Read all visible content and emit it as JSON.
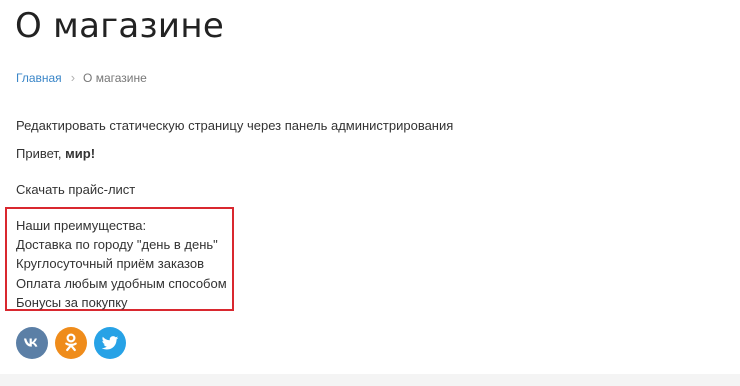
{
  "page": {
    "title": "О магазине"
  },
  "breadcrumb": {
    "home": "Главная",
    "separator": "›",
    "current": "О магазине"
  },
  "content": {
    "edit_text": "Редактировать статическую страницу через панель администрирования",
    "greeting_prefix": "Привет, ",
    "greeting_bold": "мир!",
    "download_price": "Скачать прайс-лист"
  },
  "advantages": {
    "heading": "Наши преимущества:",
    "items": [
      "Доставка по городу \"день в день\"",
      "Круглосуточный приём заказов",
      "Оплата любым удобным способом",
      "Бонусы за покупку"
    ],
    "highlight_color": "#d9282f"
  },
  "social": {
    "buttons": [
      {
        "icon": "vk-icon",
        "color": "#5b7fa6"
      },
      {
        "icon": "odnoklassniki-icon",
        "color": "#ef8c1b"
      },
      {
        "icon": "twitter-icon",
        "color": "#27a2e6"
      }
    ]
  },
  "colors": {
    "link": "#3a86c8",
    "text": "#333333"
  }
}
